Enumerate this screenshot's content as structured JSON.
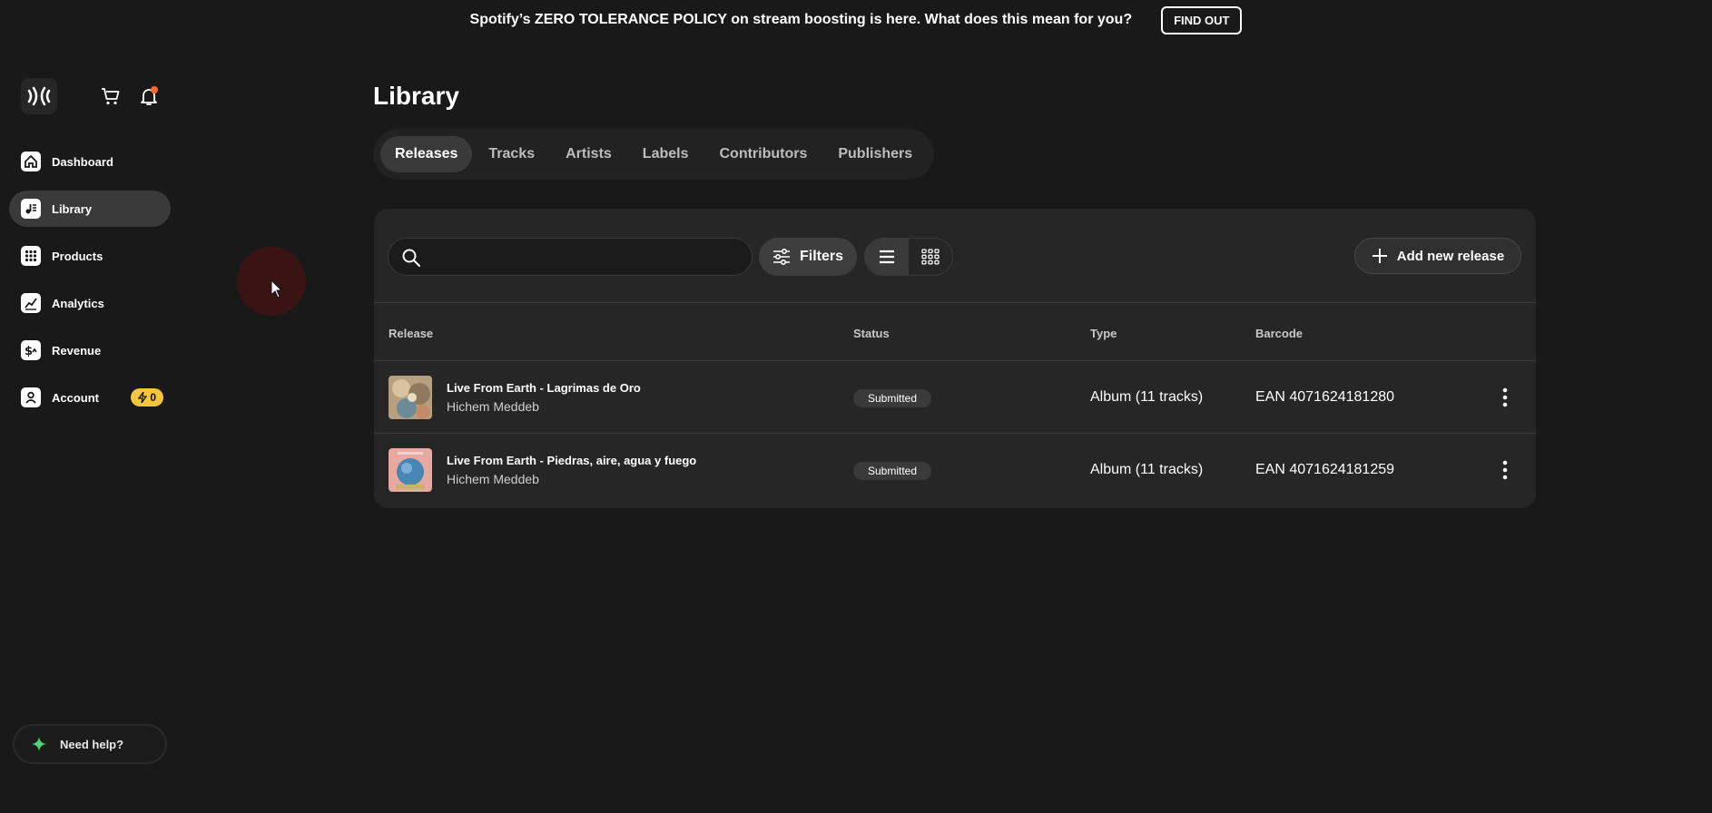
{
  "banner": {
    "text": "Spotify’s ZERO TOLERANCE POLICY on stream boosting is here. What does this mean for you?",
    "button": "FIND OUT"
  },
  "sidebar": {
    "items": [
      {
        "label": "Dashboard",
        "icon": "home-icon"
      },
      {
        "label": "Library",
        "icon": "library-icon",
        "active": true
      },
      {
        "label": "Products",
        "icon": "grid-icon"
      },
      {
        "label": "Analytics",
        "icon": "chart-icon"
      },
      {
        "label": "Revenue",
        "icon": "dollar-icon"
      },
      {
        "label": "Account",
        "icon": "user-icon",
        "badge": "0"
      }
    ],
    "help": "Need help?"
  },
  "main": {
    "title": "Library",
    "tabs": [
      {
        "label": "Releases",
        "active": true
      },
      {
        "label": "Tracks"
      },
      {
        "label": "Artists"
      },
      {
        "label": "Labels"
      },
      {
        "label": "Contributors"
      },
      {
        "label": "Publishers"
      }
    ],
    "search": {
      "value": "",
      "placeholder": ""
    },
    "filters_label": "Filters",
    "add_label": "Add new release",
    "columns": [
      "Release",
      "Status",
      "Type",
      "Barcode"
    ],
    "rows": [
      {
        "title": "Live From Earth - Lagrimas de Oro",
        "artist": "Hichem Meddeb",
        "status": "Submitted",
        "type": "Album (11 tracks)",
        "barcode": "EAN 4071624181280"
      },
      {
        "title": "Live From Earth - Piedras, aire, agua y fuego",
        "artist": "Hichem Meddeb",
        "status": "Submitted",
        "type": "Album (11 tracks)",
        "barcode": "EAN 4071624181259"
      }
    ]
  },
  "colors": {
    "background": "#191919",
    "panel": "#262626",
    "badge": "#f5c53a",
    "notification_dot": "#ff6a2a",
    "help_sparkle": "#4fd07a"
  }
}
